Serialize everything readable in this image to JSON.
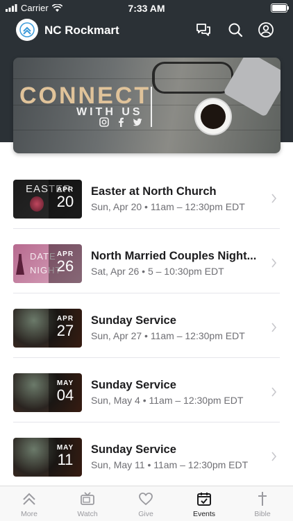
{
  "status_bar": {
    "carrier": "Carrier",
    "time": "7:33 AM"
  },
  "header": {
    "title": "NC Rockmart"
  },
  "hero": {
    "line1": "CONNECT",
    "line2": "WITH US"
  },
  "events": [
    {
      "title": "Easter at North Church",
      "when": "Sun, Apr 20 • 11am – 12:30pm EDT",
      "month": "APR",
      "day": "20",
      "thumb_text": "EASTER"
    },
    {
      "title": "North Married Couples Night...",
      "when": "Sat, Apr 26 • 5 – 10:30pm EDT",
      "month": "APR",
      "day": "26",
      "thumb_text": "DATE NIGHT"
    },
    {
      "title": "Sunday Service",
      "when": "Sun, Apr 27 • 11am – 12:30pm EDT",
      "month": "APR",
      "day": "27"
    },
    {
      "title": "Sunday Service",
      "when": "Sun, May 4 • 11am – 12:30pm EDT",
      "month": "MAY",
      "day": "04"
    },
    {
      "title": "Sunday Service",
      "when": "Sun, May 11 • 11am – 12:30pm EDT",
      "month": "MAY",
      "day": "11"
    }
  ],
  "tabs": [
    {
      "label": "More",
      "icon": "chevrons-up-icon"
    },
    {
      "label": "Watch",
      "icon": "tv-icon"
    },
    {
      "label": "Give",
      "icon": "heart-icon"
    },
    {
      "label": "Events",
      "icon": "calendar-icon",
      "active": true
    },
    {
      "label": "Bible",
      "icon": "cross-icon"
    }
  ],
  "colors": {
    "header_bg": "#2b3136",
    "accent_text": "#e0c39a",
    "tab_inactive": "#9a9a9f",
    "tab_active": "#1c1c1e"
  }
}
